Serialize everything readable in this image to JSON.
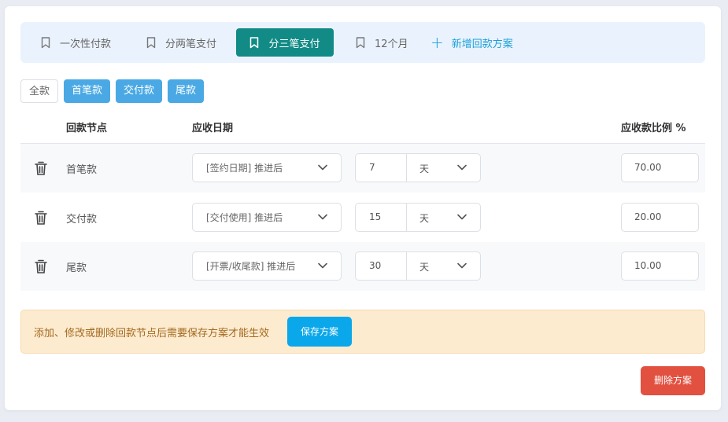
{
  "tabs": [
    {
      "label": "一次性付款",
      "icon": "bookmark-icon",
      "active": false
    },
    {
      "label": "分两笔支付",
      "icon": "bookmark-icon",
      "active": false
    },
    {
      "label": "分三笔支付",
      "icon": "bookmark-icon",
      "active": true
    },
    {
      "label": "12个月",
      "icon": "bookmark-icon",
      "active": false
    }
  ],
  "add_plan": {
    "label": "新增回款方案",
    "icon": "plus-icon"
  },
  "filters": [
    "全款",
    "首笔款",
    "交付款",
    "尾款"
  ],
  "table": {
    "headers": {
      "node": "回款节点",
      "date": "应收日期",
      "ratio": "应收款比例 %"
    },
    "rows": [
      {
        "node": "首笔款",
        "trigger": "[签约日期] 推进后",
        "offset": "7",
        "unit": "天",
        "ratio": "70.00"
      },
      {
        "node": "交付款",
        "trigger": "[交付使用] 推进后",
        "offset": "15",
        "unit": "天",
        "ratio": "20.00"
      },
      {
        "node": "尾款",
        "trigger": "[开票/收尾款] 推进后",
        "offset": "30",
        "unit": "天",
        "ratio": "10.00"
      }
    ]
  },
  "notice": {
    "message": "添加、修改或删除回款节点后需要保存方案才能生效",
    "save_label": "保存方案"
  },
  "delete_label": "删除方案",
  "colors": {
    "accent": "#128b86",
    "tag_blue": "#4aa9e4",
    "save_blue": "#0aa7ea",
    "danger": "#e25040",
    "notice_bg": "#fdebd0"
  }
}
